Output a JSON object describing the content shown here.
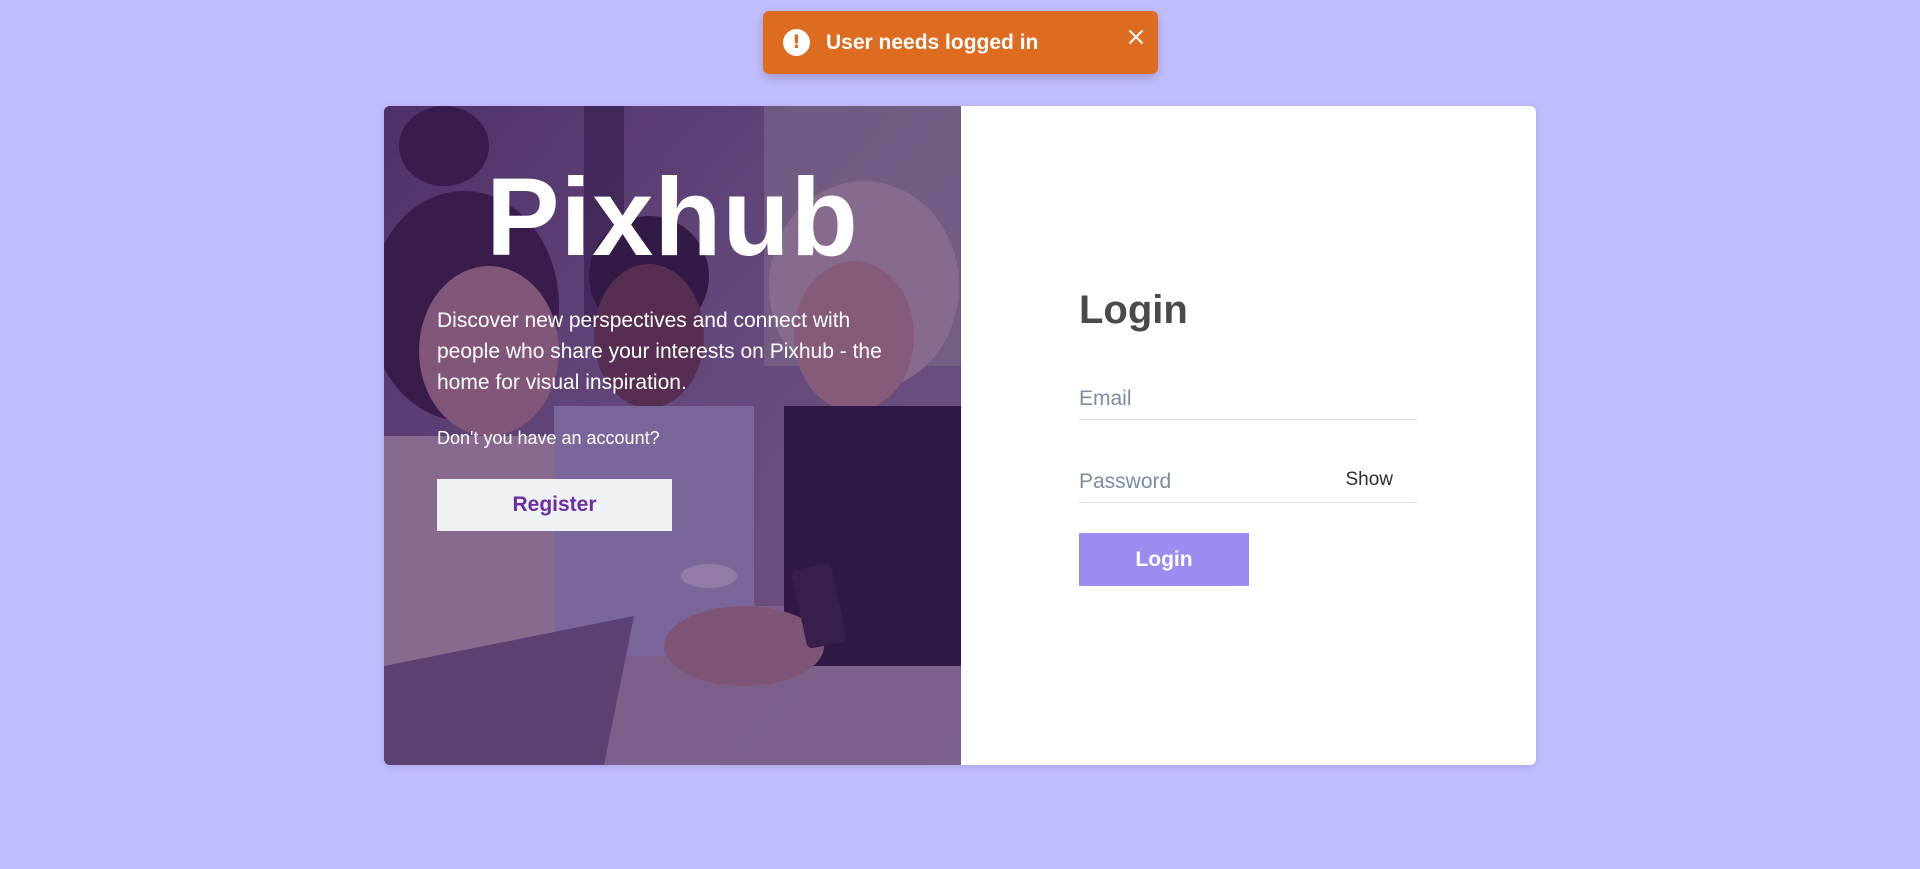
{
  "toast": {
    "message": "User needs logged in",
    "icon": "alert-circle-icon",
    "close_icon": "close-icon",
    "color": "#dd6b20"
  },
  "hero": {
    "brand": "Pixhub",
    "tagline": "Discover new perspectives and connect with people who share your interests on Pixhub - the home for visual inspiration.",
    "question": "Don't you have an account?",
    "register_label": "Register",
    "overlay_color": "#461e6e"
  },
  "login": {
    "title": "Login",
    "email_placeholder": "Email",
    "password_placeholder": "Password",
    "show_label": "Show",
    "submit_label": "Login",
    "accent": "#9a8cf0"
  },
  "page": {
    "background": "#c0bdfd"
  }
}
